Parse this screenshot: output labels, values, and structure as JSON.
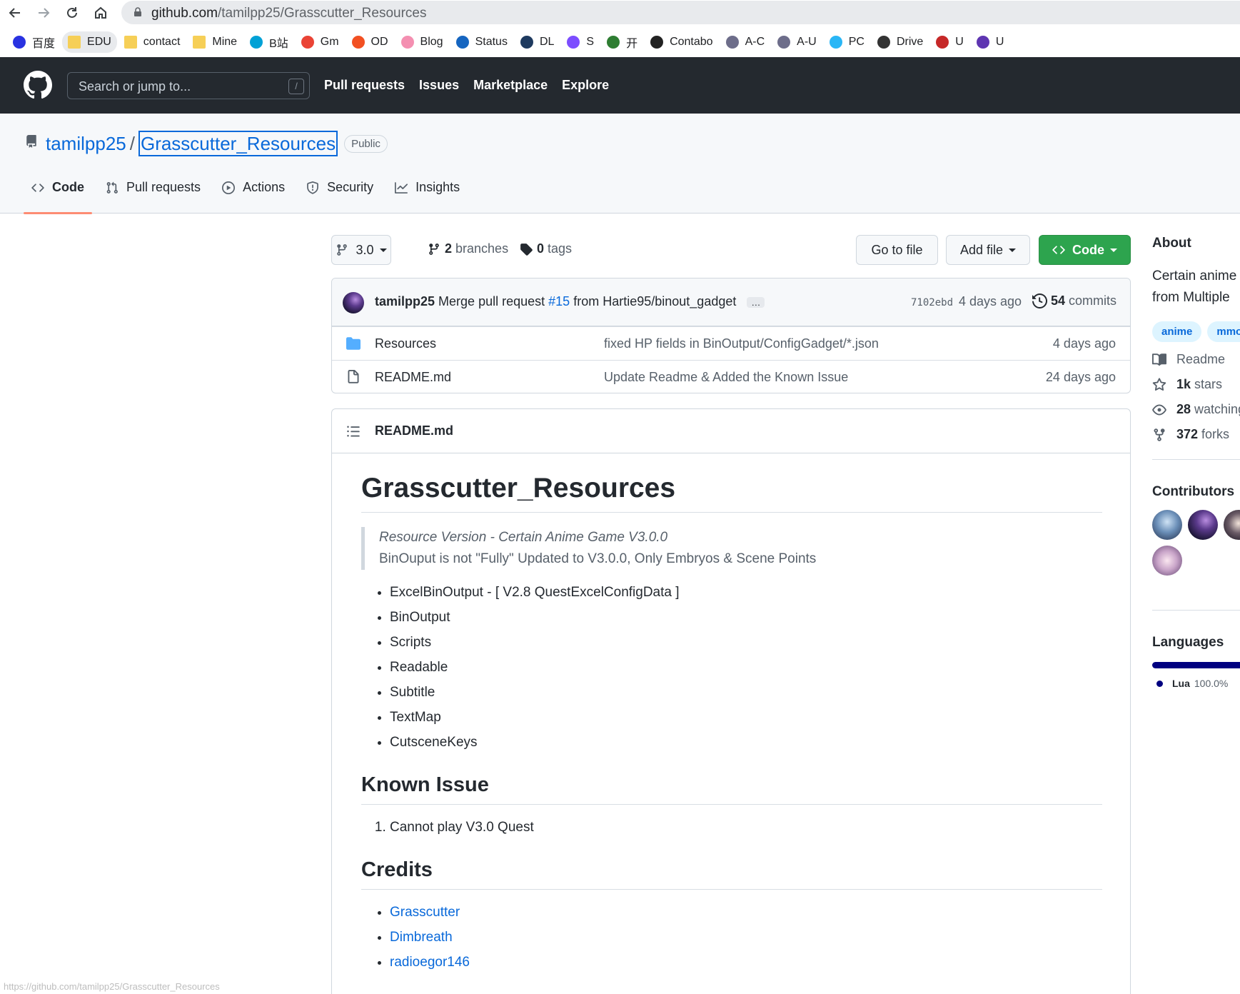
{
  "browser": {
    "url_host": "github.com",
    "url_path": "/tamilpp25/Grasscutter_Resources",
    "bookmarks": [
      {
        "label": "百度",
        "icon": "baidu-icon",
        "color": "#2932e1"
      },
      {
        "label": "EDU",
        "icon": "folder-icon",
        "color": "#f6cf57",
        "active": true
      },
      {
        "label": "contact",
        "icon": "folder-icon",
        "color": "#f6cf57"
      },
      {
        "label": "Mine",
        "icon": "folder-icon",
        "color": "#f6cf57"
      },
      {
        "label": "B站",
        "icon": "bilibili-icon",
        "color": "#00a1d6"
      },
      {
        "label": "Gm",
        "icon": "gmail-icon",
        "color": "#ea4335"
      },
      {
        "label": "OD",
        "icon": "office-icon",
        "color": "#f25022"
      },
      {
        "label": "Blog",
        "icon": "blog-icon",
        "color": "#f48fb1"
      },
      {
        "label": "Status",
        "icon": "status-icon",
        "color": "#1565c0"
      },
      {
        "label": "DL",
        "icon": "dl-icon",
        "color": "#1e3a5f"
      },
      {
        "label": "S",
        "icon": "s-icon",
        "color": "#7c4dff"
      },
      {
        "label": "开",
        "icon": "kai-icon",
        "color": "#2e7d32"
      },
      {
        "label": "Contabo",
        "icon": "contabo-icon",
        "color": "#222222"
      },
      {
        "label": "A-C",
        "icon": "ac-icon",
        "color": "#6d6d8a"
      },
      {
        "label": "A-U",
        "icon": "au-icon",
        "color": "#6d6d8a"
      },
      {
        "label": "PC",
        "icon": "pc-icon",
        "color": "#29b6f6"
      },
      {
        "label": "Drive",
        "icon": "drive-icon",
        "color": "#333333"
      },
      {
        "label": "U",
        "icon": "u-book-icon",
        "color": "#c62828"
      },
      {
        "label": "U",
        "icon": "u-circle-icon",
        "color": "#5e35b1"
      }
    ]
  },
  "header": {
    "search_placeholder": "Search or jump to...",
    "search_shortcut": "/",
    "nav": [
      "Pull requests",
      "Issues",
      "Marketplace",
      "Explore"
    ]
  },
  "repo": {
    "owner": "tamilpp25",
    "separator": "/",
    "name": "Grasscutter_Resources",
    "visibility": "Public",
    "tabs": [
      {
        "label": "Code",
        "icon": "code-icon",
        "selected": true
      },
      {
        "label": "Pull requests",
        "icon": "pull-request-icon"
      },
      {
        "label": "Actions",
        "icon": "play-icon"
      },
      {
        "label": "Security",
        "icon": "shield-icon"
      },
      {
        "label": "Insights",
        "icon": "graph-icon"
      }
    ]
  },
  "toolbar": {
    "branch": "3.0",
    "branches_count": "2",
    "branches_label": "branches",
    "tags_count": "0",
    "tags_label": "tags",
    "go_to_file": "Go to file",
    "add_file": "Add file",
    "code": "Code"
  },
  "commit": {
    "author": "tamilpp25",
    "message_pre": "Merge pull request",
    "pr": "#15",
    "message_post": "from Hartie95/binout_gadget",
    "ellipsis": "…",
    "hash": "7102ebd",
    "time": "4 days ago",
    "count": "54",
    "count_label": "commits"
  },
  "files": [
    {
      "name": "Resources",
      "type": "folder",
      "message": "fixed HP fields in BinOutput/ConfigGadget/*.json",
      "age": "4 days ago"
    },
    {
      "name": "README.md",
      "type": "file",
      "message": "Update Readme & Added the Known Issue",
      "age": "24 days ago"
    }
  ],
  "readme": {
    "filename": "README.md",
    "title": "Grasscutter_Resources",
    "quote_line1": "Resource Version - Certain Anime Game V3.0.0",
    "quote_line2": "BinOuput is not \"Fully\" Updated to V3.0.0, Only Embryos & Scene Points",
    "items": [
      "ExcelBinOutput - [ V2.8 QuestExcelConfigData ]",
      "BinOutput",
      "Scripts",
      "Readable",
      "Subtitle",
      "TextMap",
      "CutsceneKeys"
    ],
    "known_issue_heading": "Known Issue",
    "known_issues": [
      "Cannot play V3.0 Quest"
    ],
    "credits_heading": "Credits",
    "credits": [
      "Grasscutter",
      "Dimbreath",
      "radioegor146"
    ]
  },
  "sidebar": {
    "about_heading": "About",
    "description_line1": "Certain anime",
    "description_line2": "from Multiple",
    "topics": [
      "anime",
      "mmo"
    ],
    "stats": [
      {
        "icon": "book-icon",
        "count": "",
        "label": "Readme"
      },
      {
        "icon": "star-icon",
        "count": "1k",
        "label": "stars"
      },
      {
        "icon": "eye-icon",
        "count": "28",
        "label": "watching"
      },
      {
        "icon": "fork-icon",
        "count": "372",
        "label": "forks"
      }
    ],
    "contributors_heading": "Contributors",
    "languages_heading": "Languages",
    "language": {
      "name": "Lua",
      "percent": "100.0%",
      "color": "#000080"
    }
  },
  "status_bar_url": "https://github.com/tamilpp25/Grasscutter_Resources"
}
